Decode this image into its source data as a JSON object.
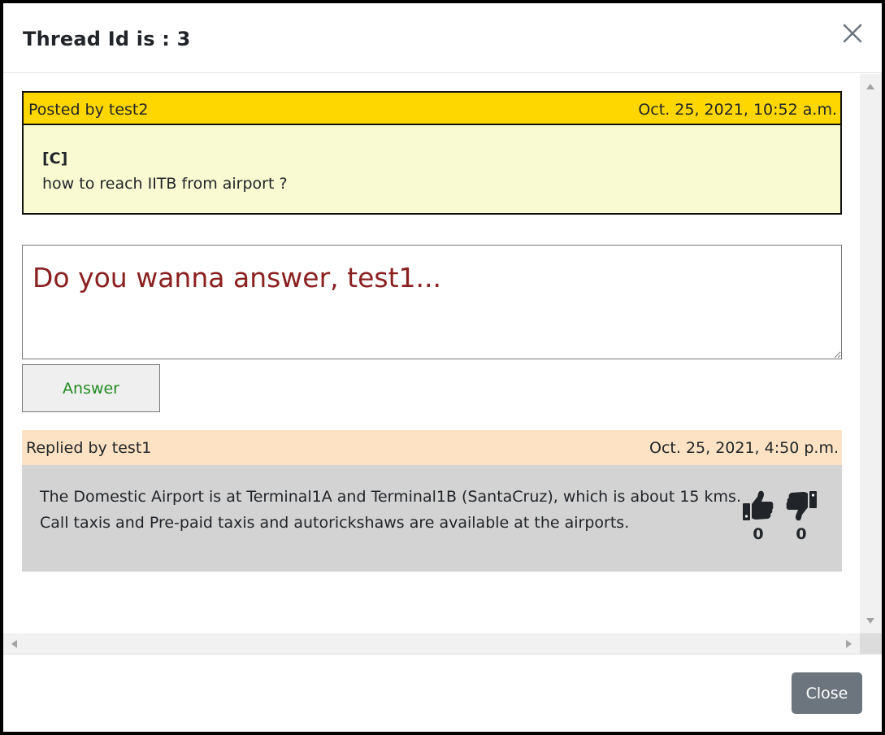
{
  "modal": {
    "title": "Thread Id is : 3",
    "close_icon": "close-x-icon"
  },
  "post": {
    "author_line": "Posted by test2",
    "date": "Oct. 25, 2021, 10:52 a.m.",
    "tag": "[C]",
    "text": "how to reach IITB from airport ?",
    "header_color": "#ffd700",
    "body_color": "#fafad2"
  },
  "answer": {
    "placeholder": "Do you wanna answer, test1...",
    "value": "",
    "button_label": "Answer"
  },
  "replies": [
    {
      "author_line": "Replied by test1",
      "date": "Oct. 25, 2021, 4:50 p.m.",
      "line1": "The Domestic Airport is at Terminal1A and Terminal1B (SantaCruz), which is about 15 kms.",
      "line2": "Call taxis and Pre-paid taxis and autorickshaws are available at the airports.",
      "upvotes": "0",
      "downvotes": "0",
      "upvote_icon": "thumbs-up-icon",
      "downvote_icon": "thumbs-down-icon",
      "header_color": "#fde3c3",
      "body_color": "#d3d3d3"
    }
  ],
  "footer": {
    "close_label": "Close"
  }
}
